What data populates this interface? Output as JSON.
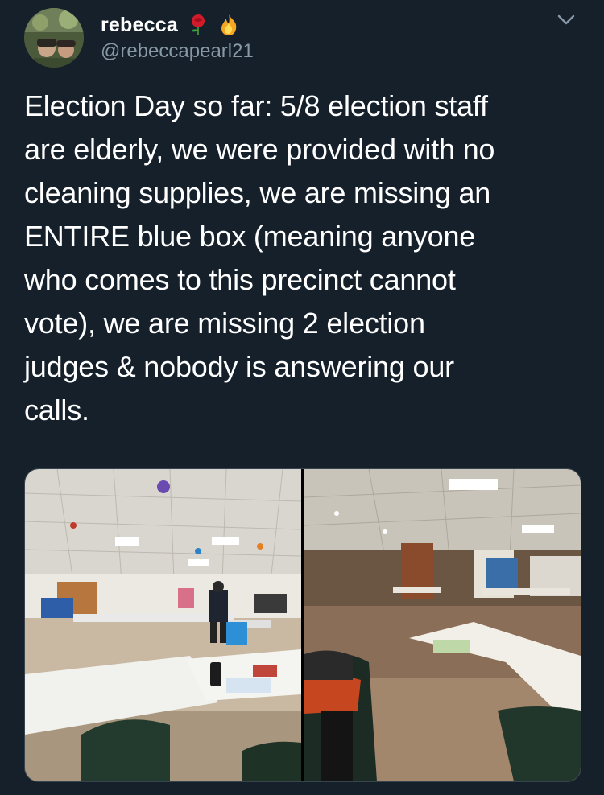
{
  "tweet": {
    "author": {
      "display_name": "rebecca",
      "handle": "@rebeccapearl21",
      "name_emojis": [
        "rose-emoji",
        "fire-emoji"
      ]
    },
    "text": "Election Day so far: 5/8 election staff\nare elderly, we were provided with no\ncleaning supplies, we are missing an\nENTIRE blue box (meaning anyone\nwho comes to this precinct cannot\nvote), we are missing 2 election\njudges & nobody is answering our\ncalls.",
    "media": [
      {
        "kind": "photo"
      },
      {
        "kind": "photo"
      }
    ]
  },
  "colors": {
    "background": "#15202b",
    "text_primary": "#ffffff",
    "text_secondary": "#8899a6",
    "border": "#38444d"
  }
}
